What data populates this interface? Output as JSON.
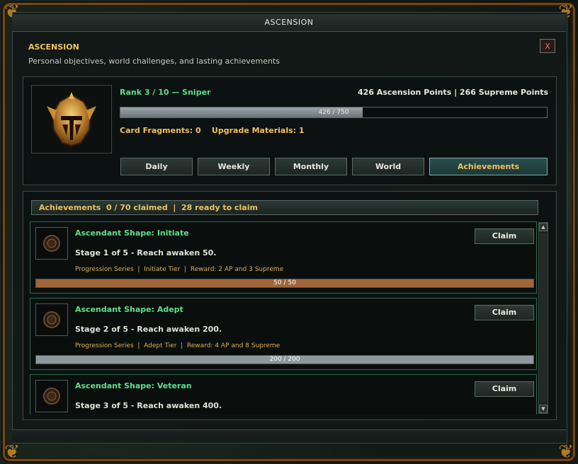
{
  "window": {
    "title": "ASCENSION"
  },
  "header": {
    "title": "ASCENSION",
    "subtitle": "Personal objectives, world challenges, and lasting achievements",
    "close_label": "X"
  },
  "profile": {
    "rank_text": "Rank 3 / 10  —  Sniper",
    "points_text": "426 Ascension Points  |  266 Supreme Points",
    "progress": {
      "current": 426,
      "max": 750,
      "label": "426 / 750"
    },
    "resources_text": "Card Fragments: 0    Upgrade Materials: 1"
  },
  "tabs": [
    {
      "label": "Daily",
      "active": false
    },
    {
      "label": "Weekly",
      "active": false
    },
    {
      "label": "Monthly",
      "active": false
    },
    {
      "label": "World",
      "active": false
    },
    {
      "label": "Achievements",
      "active": true
    }
  ],
  "list": {
    "header": "Achievements  0 / 70 claimed  |  28 ready to claim",
    "items": [
      {
        "title": "Ascendant Shape: Initiate",
        "desc": "Stage 1 of 5 - Reach awaken 50.",
        "meta": "Progression Series  |  Initiate Tier  |  Reward: 2 AP and 3 Supreme",
        "claim_label": "Claim",
        "progress_label": "50 / 50",
        "progress": 1.0,
        "bar_color": "#a0663a"
      },
      {
        "title": "Ascendant Shape: Adept",
        "desc": "Stage 2 of 5 - Reach awaken 200.",
        "meta": "Progression Series  |  Adept Tier  |  Reward: 4 AP and 8 Supreme",
        "claim_label": "Claim",
        "progress_label": "200 / 200",
        "progress": 1.0,
        "bar_color": "#8e989c"
      },
      {
        "title": "Ascendant Shape: Veteran",
        "desc": "Stage 3 of 5 - Reach awaken 400.",
        "claim_label": "Claim"
      }
    ]
  },
  "colors": {
    "accent_gold": "#f0c060",
    "accent_green": "#5ee08a"
  }
}
